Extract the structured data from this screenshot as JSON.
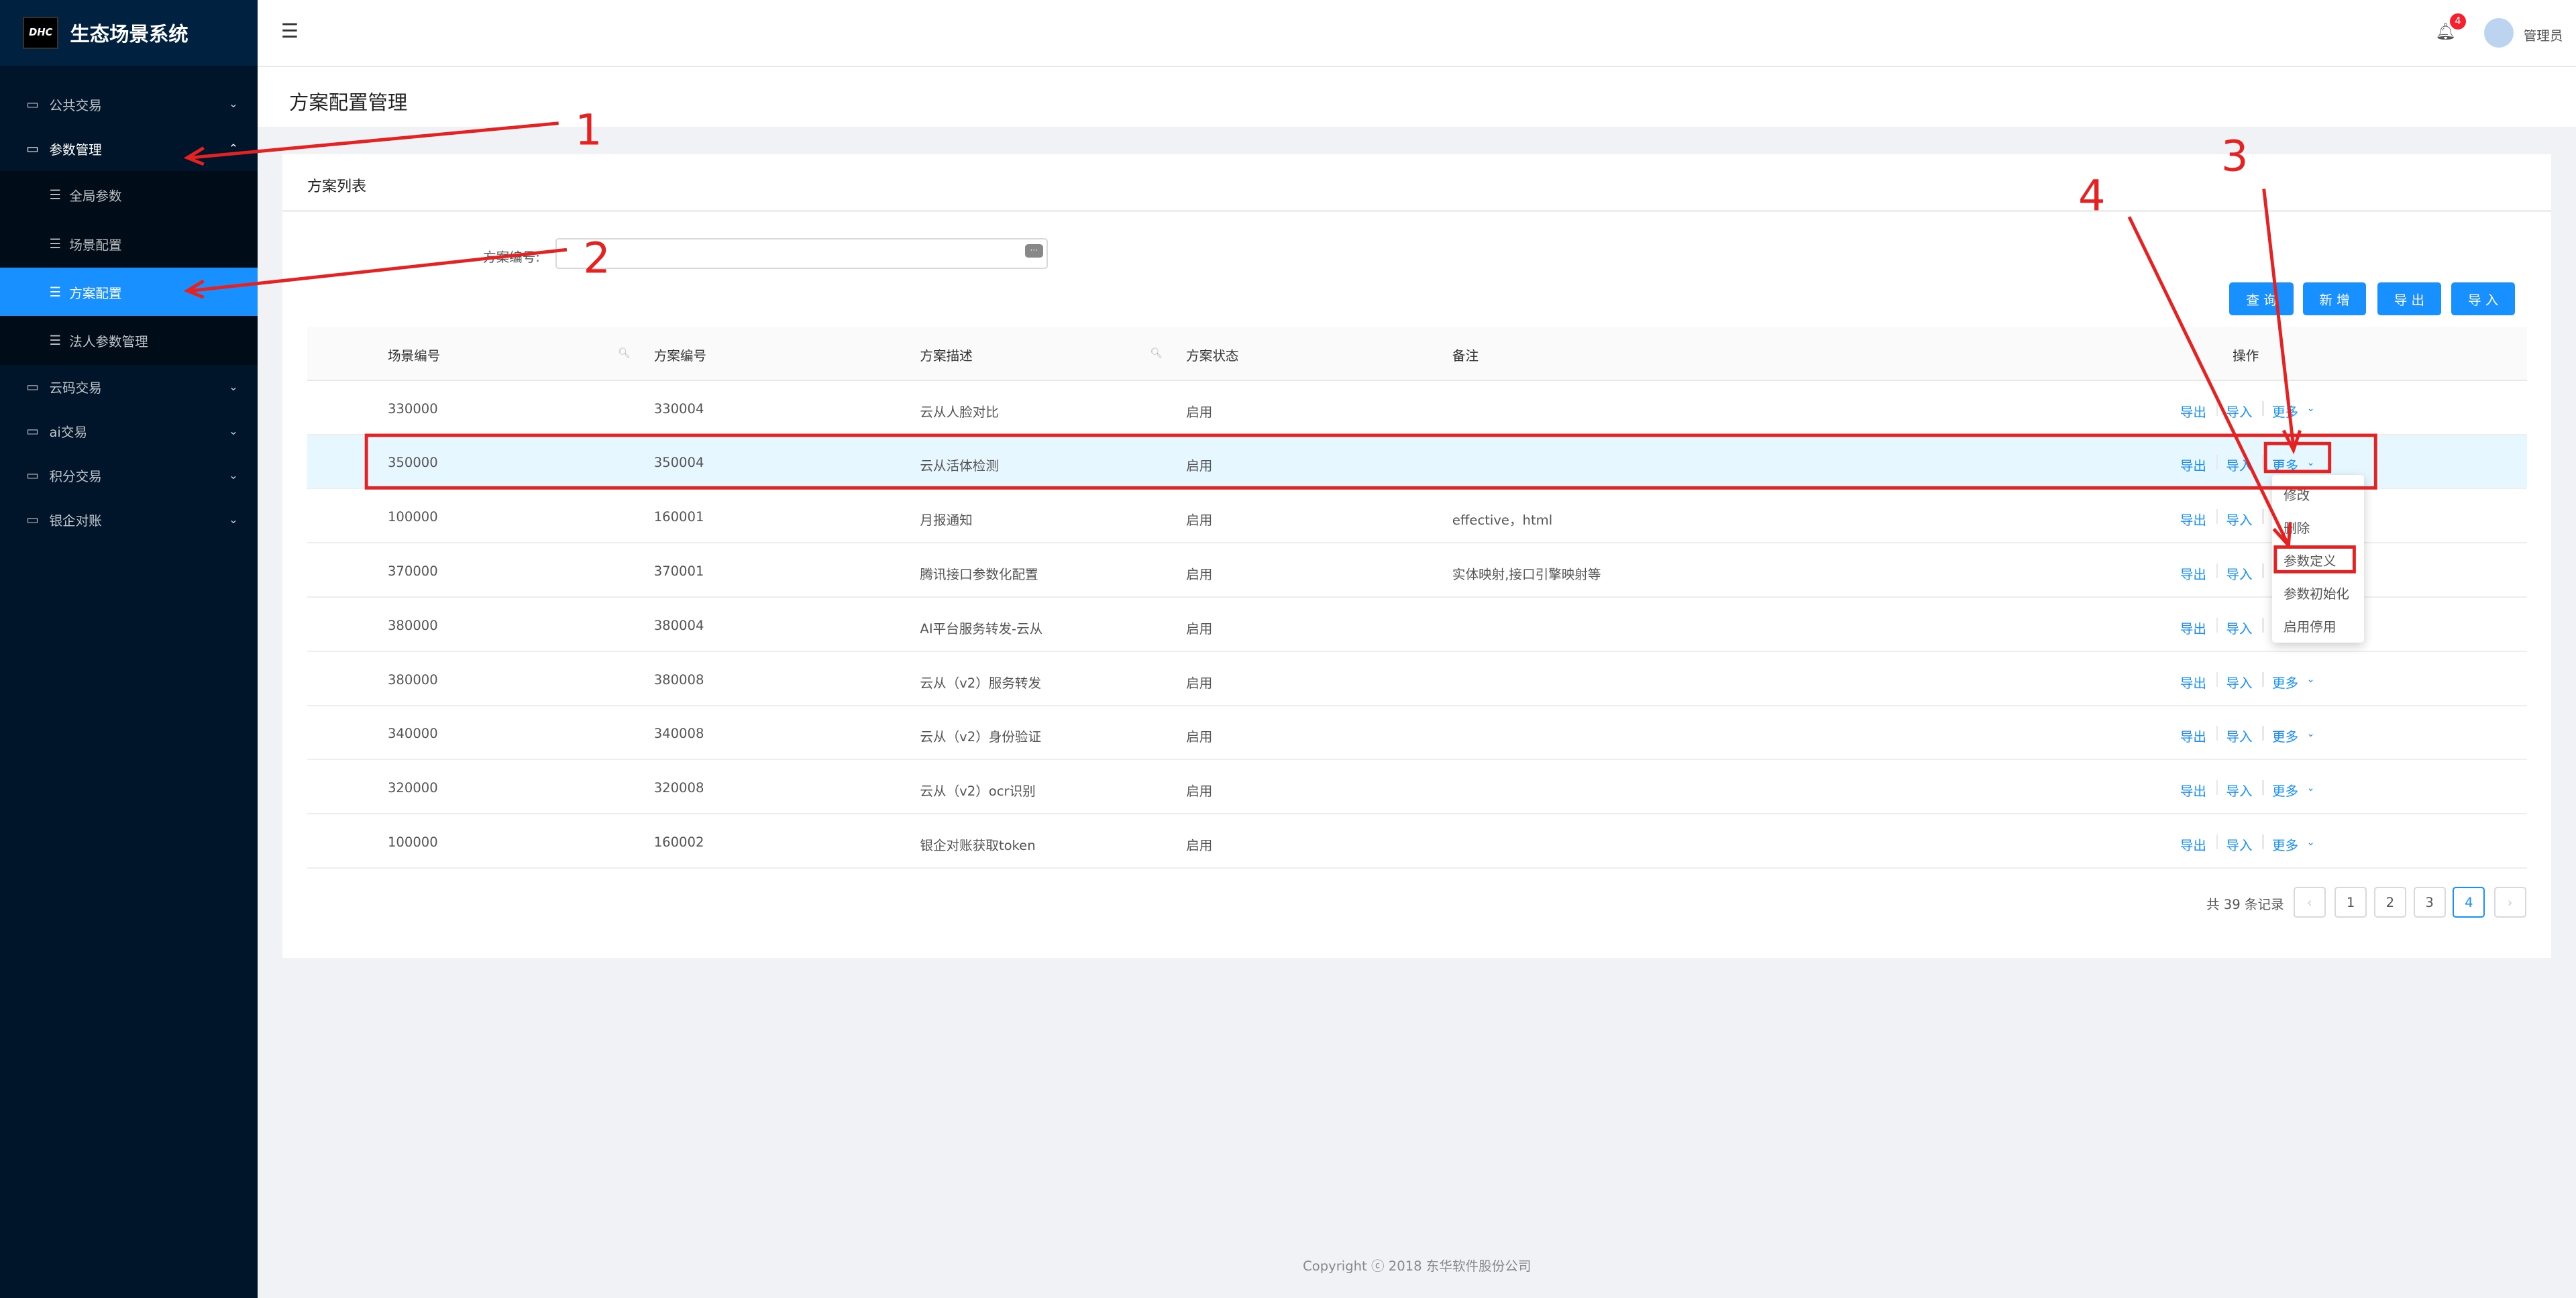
{
  "app": {
    "logo": "DHC",
    "title": "生态场景系统"
  },
  "sidebar": {
    "items": [
      {
        "label": "公共交易",
        "icon": "folder-icon"
      },
      {
        "label": "参数管理",
        "icon": "folder-icon",
        "open": true
      },
      {
        "label": "云码交易",
        "icon": "folder-icon"
      },
      {
        "label": "ai交易",
        "icon": "folder-icon"
      },
      {
        "label": "积分交易",
        "icon": "folder-icon"
      },
      {
        "label": "银企对账",
        "icon": "folder-icon"
      }
    ],
    "subitems": [
      {
        "label": "全局参数"
      },
      {
        "label": "场景配置"
      },
      {
        "label": "方案配置",
        "active": true
      },
      {
        "label": "法人参数管理"
      }
    ]
  },
  "header": {
    "badge": "4",
    "username": "管理员"
  },
  "page": {
    "title": "方案配置管理"
  },
  "card": {
    "title": "方案列表"
  },
  "filter": {
    "label": "方案编号:",
    "value": ""
  },
  "buttons": {
    "query": "查 询",
    "add": "新 增",
    "export": "导 出",
    "import": "导 入"
  },
  "table": {
    "headers": [
      "场景编号",
      "方案编号",
      "方案描述",
      "方案状态",
      "备注",
      "操作"
    ],
    "actions": {
      "export": "导出",
      "import": "导入",
      "more": "更多"
    },
    "rows": [
      {
        "scene": "330000",
        "plan": "330004",
        "desc": "云从人脸对比",
        "status": "启用",
        "remark": ""
      },
      {
        "scene": "350000",
        "plan": "350004",
        "desc": "云从活体检测",
        "status": "启用",
        "remark": ""
      },
      {
        "scene": "100000",
        "plan": "160001",
        "desc": "月报通知",
        "status": "启用",
        "remark": "effective，html"
      },
      {
        "scene": "370000",
        "plan": "370001",
        "desc": "腾讯接口参数化配置",
        "status": "启用",
        "remark": "实体映射,接口引擎映射等"
      },
      {
        "scene": "380000",
        "plan": "380004",
        "desc": "AI平台服务转发-云从",
        "status": "启用",
        "remark": ""
      },
      {
        "scene": "380000",
        "plan": "380008",
        "desc": "云从（v2）服务转发",
        "status": "启用",
        "remark": ""
      },
      {
        "scene": "340000",
        "plan": "340008",
        "desc": "云从（v2）身份验证",
        "status": "启用",
        "remark": ""
      },
      {
        "scene": "320000",
        "plan": "320008",
        "desc": "云从（v2）ocr识别",
        "status": "启用",
        "remark": ""
      },
      {
        "scene": "100000",
        "plan": "160002",
        "desc": "银企对账获取token",
        "status": "启用",
        "remark": ""
      }
    ]
  },
  "pagination": {
    "total": "共 39 条记录",
    "pages": [
      "1",
      "2",
      "3",
      "4"
    ],
    "current": "4"
  },
  "dropdown": {
    "items": [
      "修改",
      "删除",
      "参数定义",
      "参数初始化",
      "启用停用"
    ]
  },
  "footer": {
    "copyright": "Copyright ⓒ 2018 东华软件股份公司"
  },
  "annotations": {
    "marks": [
      "1",
      "2",
      "3",
      "4"
    ],
    "color": "#e52222"
  },
  "colors": {
    "sidebar": "#001529",
    "primary": "#1890ff",
    "highlight": "#e6f7ff"
  }
}
